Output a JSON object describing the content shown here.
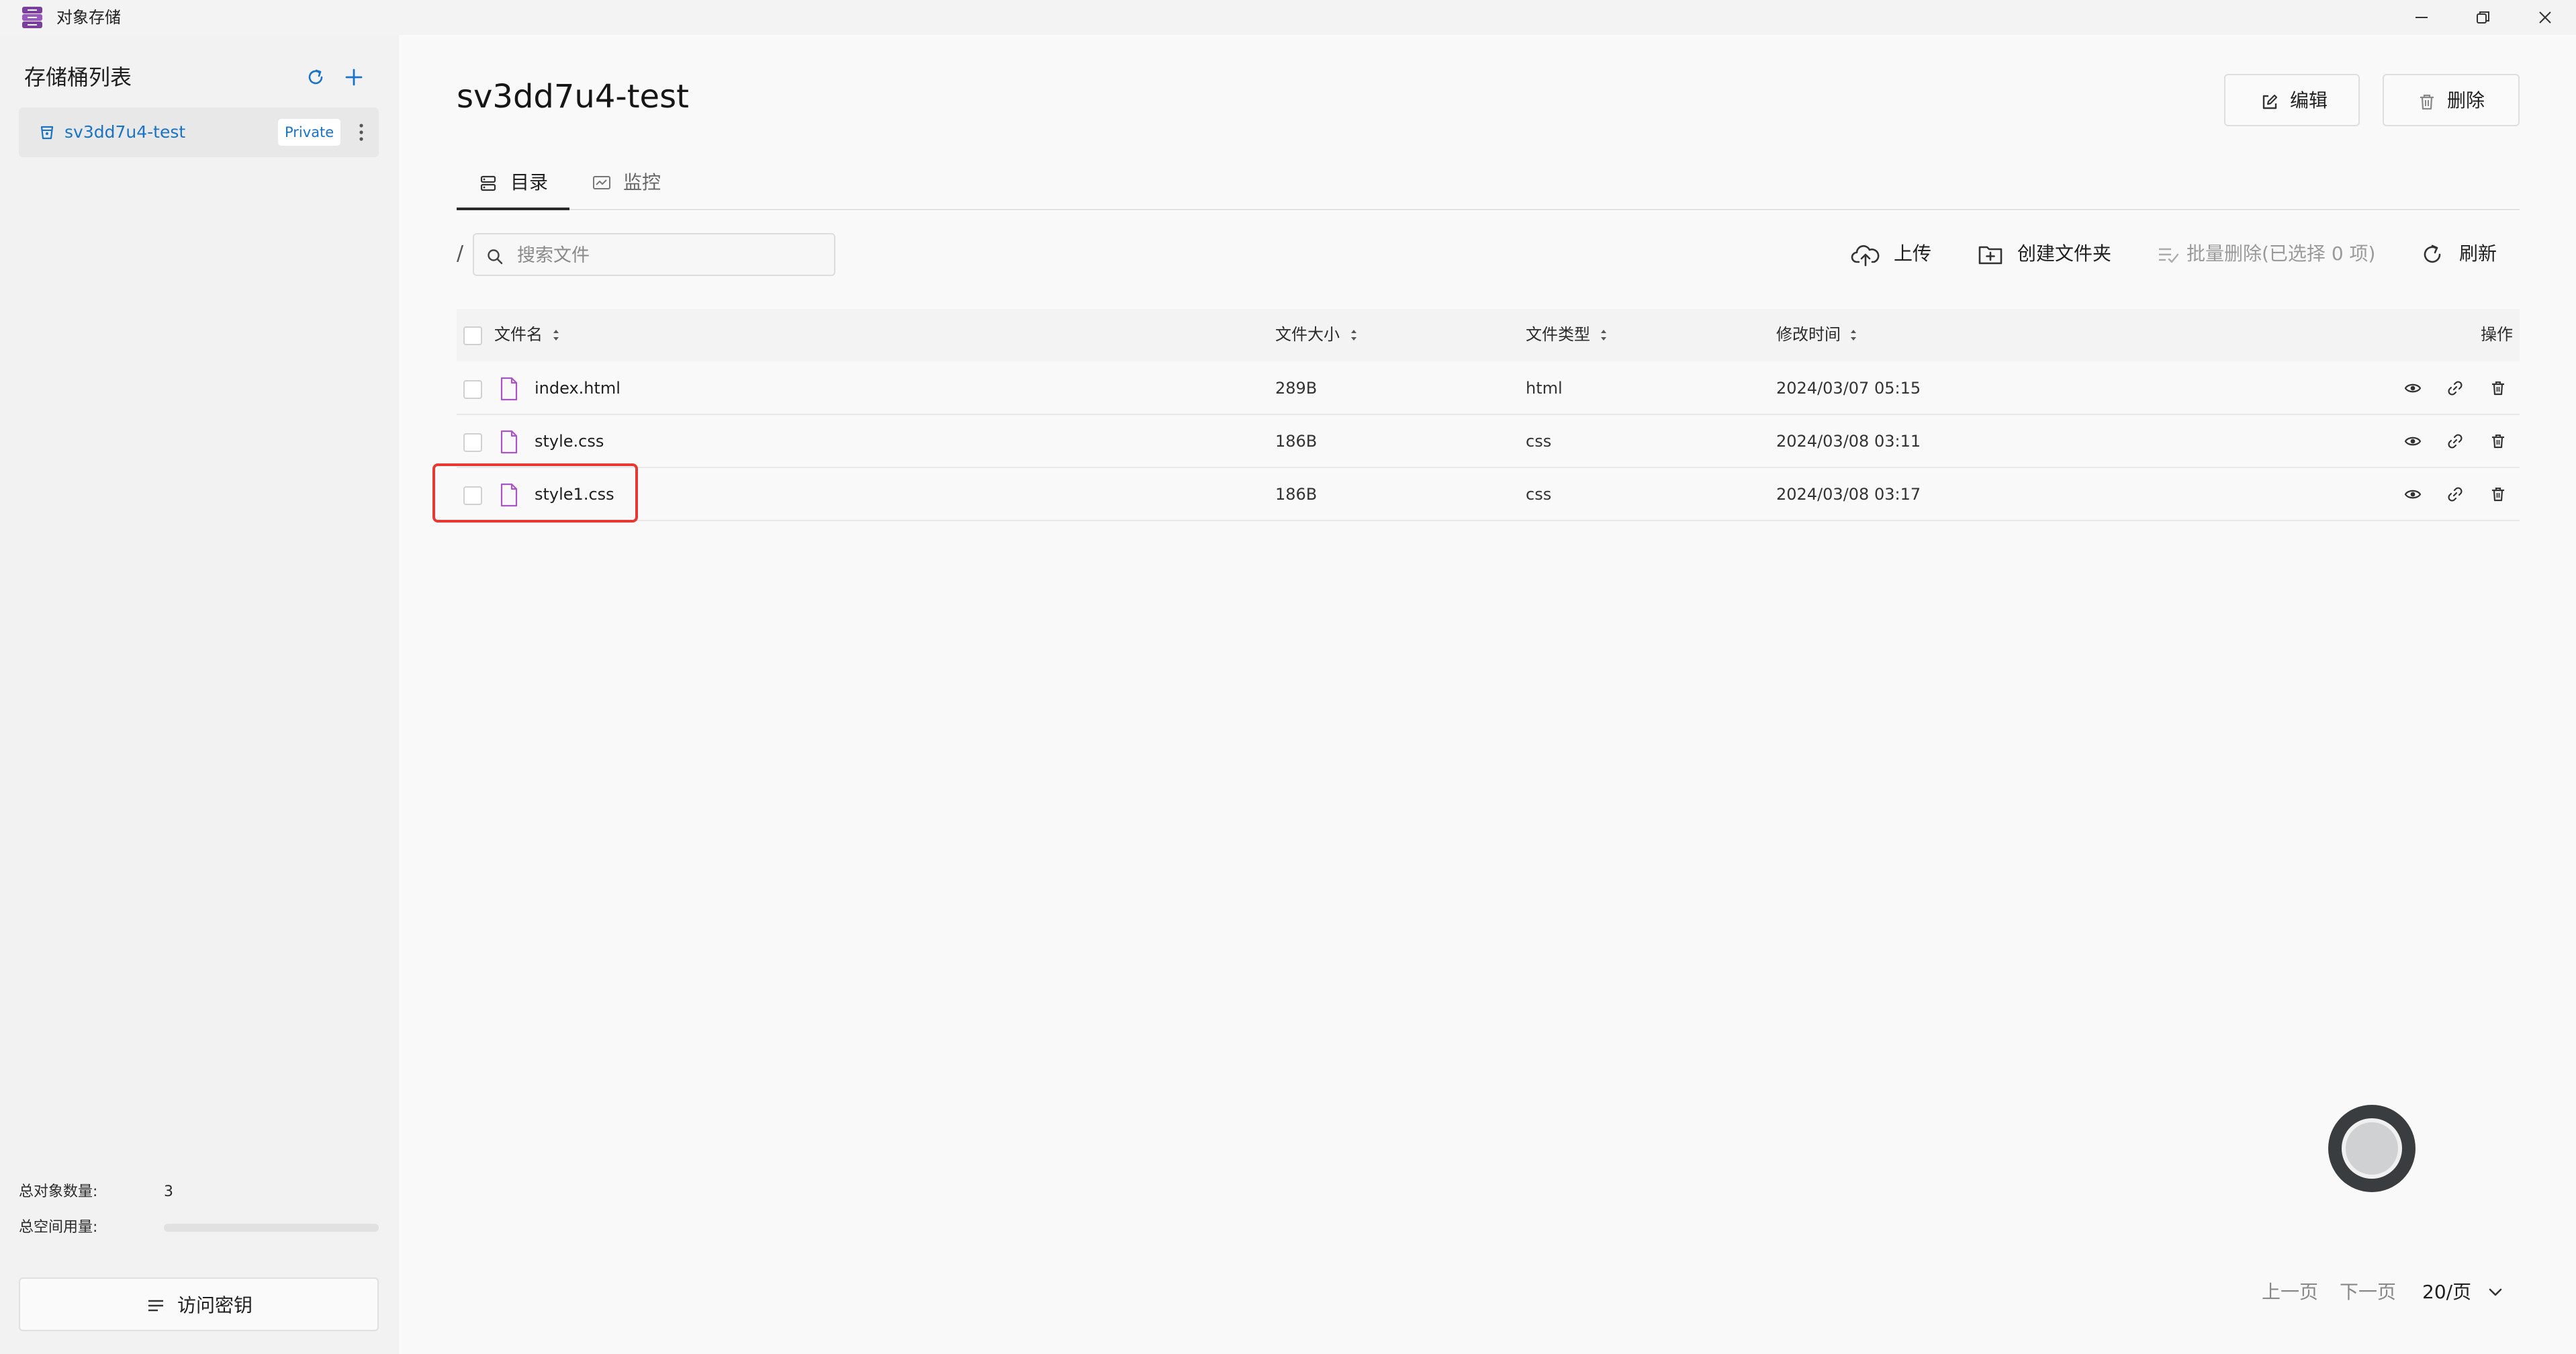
{
  "window": {
    "title": "对象存储"
  },
  "sidebar": {
    "title": "存储桶列表",
    "buckets": [
      {
        "name": "sv3dd7u4-test",
        "badge": "Private"
      }
    ],
    "stats": {
      "object_count_label": "总对象数量:",
      "object_count_value": "3",
      "space_used_label": "总空间用量:",
      "space_used_fraction": 0
    },
    "access_key_label": "访问密钥"
  },
  "main": {
    "title": "sv3dd7u4-test",
    "edit_label": "编辑",
    "delete_label": "删除",
    "tabs": [
      {
        "label": "目录"
      },
      {
        "label": "监控"
      }
    ],
    "path": "/",
    "search_placeholder": "搜索文件",
    "toolbar": {
      "upload": "上传",
      "new_folder": "创建文件夹",
      "batch_delete": "批量删除(已选择 0 项)",
      "refresh": "刷新"
    },
    "table": {
      "columns": [
        "文件名",
        "文件大小",
        "文件类型",
        "修改时间",
        "操作"
      ],
      "rows": [
        {
          "name": "index.html",
          "size": "289B",
          "type": "html",
          "modified": "2024/03/07 05:15"
        },
        {
          "name": "style.css",
          "size": "186B",
          "type": "css",
          "modified": "2024/03/08 03:11"
        },
        {
          "name": "style1.css",
          "size": "186B",
          "type": "css",
          "modified": "2024/03/08 03:17"
        }
      ]
    },
    "pagination": {
      "prev": "上一页",
      "next": "下一页",
      "page_size": "20/页"
    }
  },
  "colors": {
    "accent": "#1a73c7",
    "highlight": "#e53935",
    "file_icon": "#a855c8"
  }
}
